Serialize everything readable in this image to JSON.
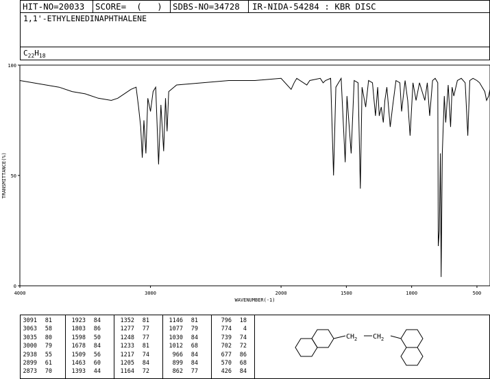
{
  "header": {
    "hit_no": "HIT-NO=20033",
    "score": "SCORE=  (   )",
    "sdbs_no": "SDBS-NO=34728",
    "ir_nida": "IR-NIDA-54284 : KBR DISC"
  },
  "compound_name": "1,1'-ETHYLENEDINAPHTHALENE",
  "formula": {
    "c": "C",
    "c_n": "22",
    "h": "H",
    "h_n": "18"
  },
  "structure": {
    "left_group": "CH",
    "left_sub": "2",
    "right_group": "CH",
    "right_sub": "2"
  },
  "chart_data": {
    "type": "line",
    "xlabel": "WAVENUMBER(-1)",
    "ylabel": "TRANSMITTANCE(%)",
    "xlim": [
      4000,
      400
    ],
    "ylim": [
      0,
      100
    ],
    "x_ticks": [
      "4000",
      "3000",
      "2000",
      "1500",
      "1000",
      "500"
    ],
    "y_ticks": [
      "100",
      "50",
      "0"
    ],
    "grid": false,
    "series": [
      {
        "x": [
          4000,
          3900,
          3800,
          3700,
          3600,
          3500,
          3400,
          3300,
          3250,
          3200,
          3150,
          3110,
          3091,
          3075,
          3063,
          3050,
          3035,
          3020,
          3000,
          2980,
          2960,
          2938,
          2920,
          2899,
          2885,
          2873,
          2860,
          2800,
          2600,
          2400,
          2200,
          2000,
          1923,
          1900,
          1880,
          1803,
          1780,
          1700,
          1678,
          1660,
          1620,
          1598,
          1580,
          1540,
          1509,
          1495,
          1463,
          1440,
          1410,
          1393,
          1380,
          1352,
          1330,
          1300,
          1277,
          1260,
          1248,
          1233,
          1217,
          1205,
          1190,
          1164,
          1146,
          1120,
          1090,
          1077,
          1050,
          1030,
          1012,
          990,
          966,
          940,
          899,
          880,
          862,
          840,
          820,
          800,
          796,
          788,
          780,
          774,
          765,
          750,
          739,
          720,
          702,
          690,
          677,
          650,
          620,
          590,
          570,
          555,
          530,
          500,
          480,
          460,
          440,
          426,
          410,
          400
        ],
        "y": [
          93,
          92,
          91,
          90,
          88,
          87,
          85,
          84,
          85,
          87,
          89,
          90,
          81,
          72,
          58,
          75,
          60,
          85,
          79,
          88,
          90,
          55,
          82,
          61,
          85,
          70,
          88,
          91,
          92,
          93,
          93,
          94,
          89,
          92,
          94,
          91,
          93,
          94,
          92,
          93,
          94,
          50,
          90,
          94,
          56,
          86,
          60,
          93,
          92,
          44,
          90,
          81,
          93,
          92,
          77,
          90,
          77,
          81,
          74,
          84,
          90,
          72,
          81,
          93,
          92,
          79,
          93,
          84,
          68,
          92,
          84,
          92,
          84,
          92,
          77,
          93,
          94,
          92,
          18,
          25,
          60,
          4,
          60,
          86,
          74,
          91,
          72,
          90,
          86,
          93,
          94,
          92,
          68,
          93,
          94,
          93,
          92,
          90,
          88,
          84,
          86,
          89
        ]
      }
    ],
    "peak_table": [
      [
        [
          "3091",
          "81"
        ],
        [
          "3063",
          "58"
        ],
        [
          "3035",
          "80"
        ],
        [
          "3000",
          "79"
        ],
        [
          "2938",
          "55"
        ],
        [
          "2899",
          "61"
        ],
        [
          "2873",
          "70"
        ]
      ],
      [
        [
          "1923",
          "84"
        ],
        [
          "1803",
          "86"
        ],
        [
          "1598",
          "50"
        ],
        [
          "1678",
          "84"
        ],
        [
          "1509",
          "56"
        ],
        [
          "1463",
          "60"
        ],
        [
          "1393",
          "44"
        ]
      ],
      [
        [
          "1352",
          "81"
        ],
        [
          "1277",
          "77"
        ],
        [
          "1248",
          "77"
        ],
        [
          "1233",
          "81"
        ],
        [
          "1217",
          "74"
        ],
        [
          "1205",
          "84"
        ],
        [
          "1164",
          "72"
        ]
      ],
      [
        [
          "1146",
          "81"
        ],
        [
          "1077",
          "79"
        ],
        [
          "1030",
          "84"
        ],
        [
          "1012",
          "68"
        ],
        [
          "966",
          "84"
        ],
        [
          "899",
          "84"
        ],
        [
          "862",
          "77"
        ]
      ],
      [
        [
          "796",
          "18"
        ],
        [
          "774",
          "4"
        ],
        [
          "739",
          "74"
        ],
        [
          "702",
          "72"
        ],
        [
          "677",
          "86"
        ],
        [
          "570",
          "68"
        ],
        [
          "426",
          "84"
        ]
      ]
    ]
  }
}
